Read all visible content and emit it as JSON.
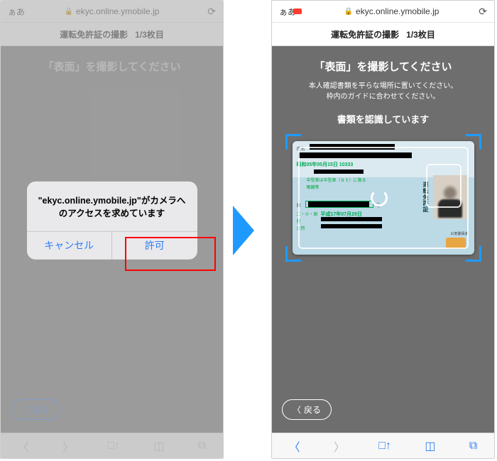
{
  "browser": {
    "aa": "ぁあ",
    "url": "ekyc.online.ymobile.jp"
  },
  "page": {
    "title": "運転免許証の撮影",
    "counter": "1/3枚目"
  },
  "camera": {
    "heading": "「表面」を撮影してください",
    "instruction_line1": "本人確認書類を平らな場所に置いてください。",
    "instruction_line2": "枠内のガイドに合わせてください。",
    "status": "書類を認識しています"
  },
  "license": {
    "name_label": "氏名",
    "dob_line": "昭和05年05月15日  10333",
    "type_line": "中型車は中型車（８ｔ）に限る",
    "glasses": "眼鏡等",
    "number_label": "第",
    "number_suffix": "号",
    "expiry": "平成17年07月29日",
    "doc_title": "運転免許証",
    "badge_label": "公安委員会",
    "row_labels": [
      "二・小・原",
      "普",
      "大特"
    ]
  },
  "dialog": {
    "message": "\"ekyc.online.ymobile.jp\"がカメラへのアクセスを求めています",
    "cancel": "キャンセル",
    "allow": "許可"
  },
  "buttons": {
    "back": "戻る"
  }
}
